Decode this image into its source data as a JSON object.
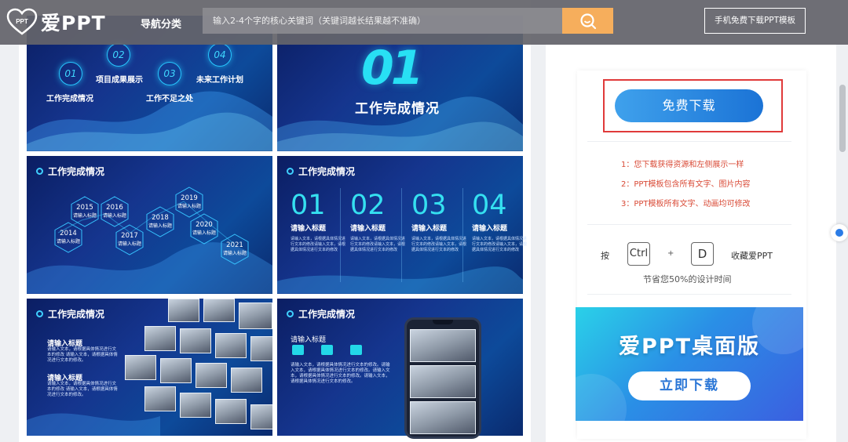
{
  "topbar": {
    "logo_text": "爱PPT",
    "logo_mark_text": "PPT",
    "nav_category": "导航分类",
    "search_placeholder": "输入2-4个字的核心关键词（关键词越长结果越不准确）",
    "mobile_button": "手机免费下载PPT模板"
  },
  "slides": {
    "s1": {
      "items": [
        {
          "num": "01",
          "label": "工作完成情况"
        },
        {
          "num": "02",
          "label": "项目成果展示"
        },
        {
          "num": "03",
          "label": "工作不足之处"
        },
        {
          "num": "04",
          "label": "未来工作计划"
        }
      ]
    },
    "s2": {
      "big_number": "01",
      "title": "工作完成情况"
    },
    "s3": {
      "title": "工作完成情况",
      "years": [
        {
          "year": "2014",
          "label": "请输入标题"
        },
        {
          "year": "2015",
          "label": "请输入标题"
        },
        {
          "year": "2016",
          "label": "请输入标题"
        },
        {
          "year": "2017",
          "label": "请输入标题"
        },
        {
          "year": "2018",
          "label": "请输入标题"
        },
        {
          "year": "2019",
          "label": "请输入标题"
        },
        {
          "year": "2020",
          "label": "请输入标题"
        },
        {
          "year": "2021",
          "label": "请输入标题"
        }
      ]
    },
    "s4": {
      "title": "工作完成情况",
      "columns": [
        {
          "num": "01",
          "title": "请输入标题",
          "text": "请输入文本，请根据具体情况进行文本的修改请输入文本，请根据具体情况进行文本的修改"
        },
        {
          "num": "02",
          "title": "请输入标题",
          "text": "请输入文本，请根据具体情况进行文本的修改请输入文本，请根据具体情况进行文本的修改"
        },
        {
          "num": "03",
          "title": "请输入标题",
          "text": "请输入文本，请根据具体情况进行文本的修改请输入文本，请根据具体情况进行文本的修改"
        },
        {
          "num": "04",
          "title": "请输入标题",
          "text": "请输入文本，请根据具体情况进行文本的修改请输入文本，请根据具体情况进行文本的修改"
        }
      ]
    },
    "s5": {
      "title": "工作完成情况",
      "blocks": [
        {
          "title": "请输入标题",
          "text": "请输入文本，请根据具体情况进行文本的修改 请输入文本，请根据具体情况进行文本的修改。"
        },
        {
          "title": "请输入标题",
          "text": "请输入文本，请根据具体情况进行文本的修改 请输入文本，请根据具体情况进行文本的修改。"
        }
      ]
    },
    "s6": {
      "title": "工作完成情况",
      "subtitle": "请输入标题",
      "text": "请输入文本，请根据具体情况进行文本的修改。请输入文本，请根据具体情况进行文本的修改。请输入文本，请根据具体情况进行文本的修改。请输入文本，请根据具体情况进行文本的修改。"
    }
  },
  "sidebar": {
    "download_button": "免费下载",
    "notes": [
      "1：您下载获得资源和左侧展示一样",
      "2：PPT模板包含所有文字、图片内容",
      "3：PPT模板所有文字、动画均可修改"
    ],
    "press_label": "按",
    "key_ctrl": "Ctrl",
    "plus": "+",
    "key_d": "D",
    "bookmark_label": "收藏爱PPT",
    "save_time_text": "节省您50%的设计时间",
    "banner_title": "爱PPT桌面版",
    "banner_button": "立即下载"
  },
  "colors": {
    "accent_cyan": "#35e0f0",
    "download_blue": "#1b73d6",
    "note_red": "#d94a36",
    "search_orange": "#f6ae5c",
    "highlight_red": "#e03a3a"
  }
}
